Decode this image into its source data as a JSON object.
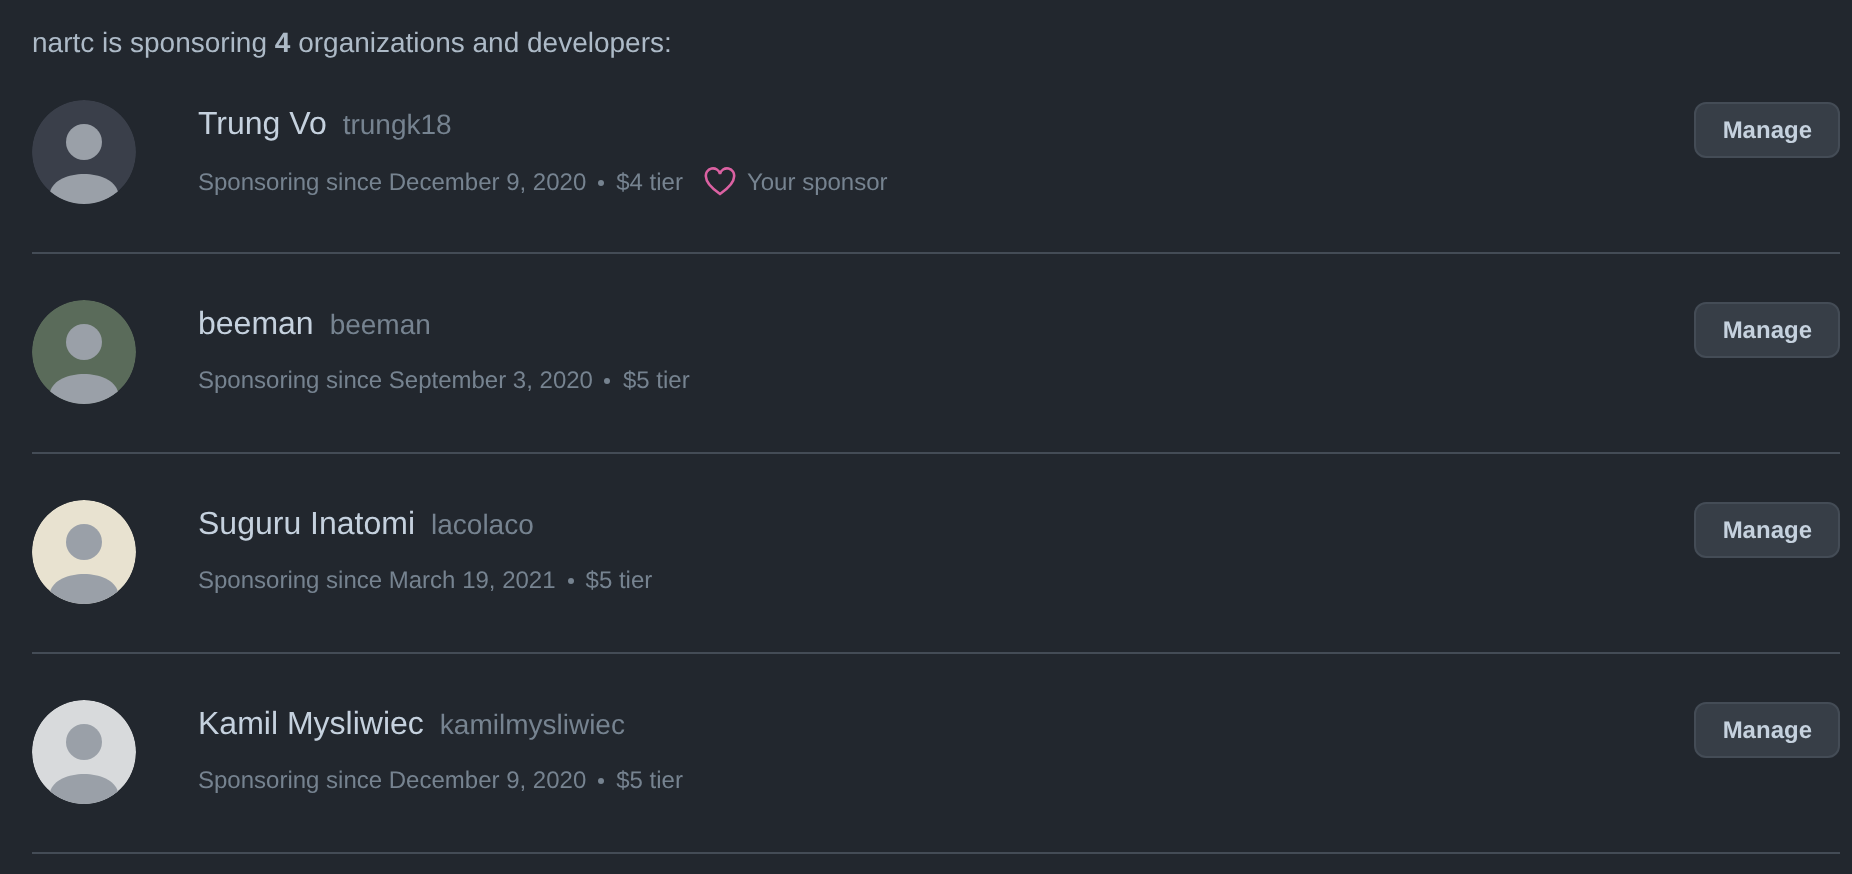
{
  "heading": "nartc is sponsoring **4** organizations and developers:",
  "sponsorships": [
    {
      "name": "Trung Vo",
      "login": "trungk18",
      "since": "Sponsoring since December 9, 2020",
      "tier": "$4 tier",
      "badge": "Your sponsor",
      "button": "Manage"
    },
    {
      "name": "beeman",
      "login": "beeman",
      "since": "Sponsoring since September 3, 2020",
      "tier": "$5 tier",
      "button": "Manage"
    },
    {
      "name": "Suguru Inatomi",
      "login": "lacolaco",
      "since": "Sponsoring since March 19, 2021",
      "tier": "$5 tier",
      "button": "Manage"
    },
    {
      "name": "Kamil Mysliwiec",
      "login": "kamilmysliwiec",
      "since": "Sponsoring since December 9, 2020",
      "tier": "$5 tier",
      "button": "Manage"
    }
  ]
}
